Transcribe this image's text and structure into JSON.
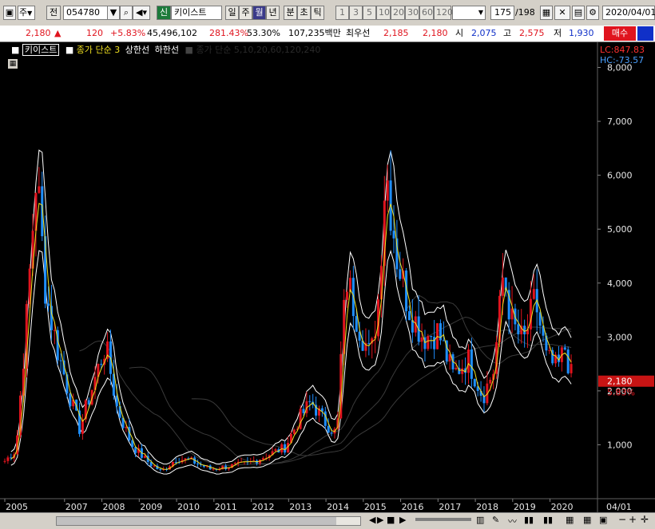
{
  "toolbar": {
    "market": "주",
    "prev_label": "전",
    "code": "054780",
    "mode_badge": "신",
    "stock_name": "키이스트",
    "periods": [
      "일",
      "주",
      "월",
      "년",
      "분",
      "초",
      "틱"
    ],
    "active_period": "월",
    "nums": [
      "1",
      "3",
      "5",
      "10",
      "20",
      "30",
      "60",
      "120"
    ],
    "page_count": "175",
    "page_total": "/198",
    "date": "2020/04/01"
  },
  "quote": {
    "price": "2,180",
    "change": "120",
    "pct": "+5.83%",
    "volume": "45,496,102",
    "vol_ratio": "281.43%",
    "turnover": "53.30%",
    "amount": "107,235백만",
    "best_label": "최우선",
    "best_ask": "2,185",
    "best_bid": "2,180",
    "open_label": "시",
    "open": "2,075",
    "high_label": "고",
    "high": "2,575",
    "low_label": "저",
    "low": "1,930",
    "buy_label": "매수"
  },
  "legend": {
    "name": "키이스트",
    "ma_label": "종가 단순 3",
    "upper": "상한선",
    "lower": "하한선",
    "ma_list": "종가 단순 5,10,20,60,120,240"
  },
  "chart_data": {
    "type": "candlestick",
    "x_ticks": [
      "2005",
      "2007",
      "2008",
      "2009",
      "2010",
      "2011",
      "2012",
      "2013",
      "2014",
      "2015",
      "2016",
      "2017",
      "2018",
      "2019",
      "2020",
      "04/01"
    ],
    "y_ticks": [
      "8,000",
      "7,000",
      "6,000",
      "5,000",
      "4,000",
      "3,000",
      "2,000",
      "1,000"
    ],
    "ylim": [
      0,
      8200
    ],
    "lc": "LC:847.83",
    "hc": "HC:-73.57",
    "last_price": "2,180",
    "last_pct": "5.83%",
    "close_profile": [
      {
        "x": 2005.0,
        "y": 700
      },
      {
        "x": 2005.3,
        "y": 900
      },
      {
        "x": 2005.6,
        "y": 3500
      },
      {
        "x": 2005.85,
        "y": 6100
      },
      {
        "x": 2006.1,
        "y": 3800
      },
      {
        "x": 2006.4,
        "y": 2800
      },
      {
        "x": 2006.7,
        "y": 2000
      },
      {
        "x": 2007.0,
        "y": 1300
      },
      {
        "x": 2007.4,
        "y": 2200
      },
      {
        "x": 2007.7,
        "y": 2850
      },
      {
        "x": 2008.0,
        "y": 1700
      },
      {
        "x": 2008.4,
        "y": 1000
      },
      {
        "x": 2008.8,
        "y": 700
      },
      {
        "x": 2009.2,
        "y": 500
      },
      {
        "x": 2009.6,
        "y": 750
      },
      {
        "x": 2010.0,
        "y": 700
      },
      {
        "x": 2010.5,
        "y": 550
      },
      {
        "x": 2011.0,
        "y": 600
      },
      {
        "x": 2011.5,
        "y": 650
      },
      {
        "x": 2012.0,
        "y": 800
      },
      {
        "x": 2012.5,
        "y": 950
      },
      {
        "x": 2012.9,
        "y": 1500
      },
      {
        "x": 2013.2,
        "y": 1800
      },
      {
        "x": 2013.6,
        "y": 1400
      },
      {
        "x": 2013.9,
        "y": 1200
      },
      {
        "x": 2014.0,
        "y": 2600
      },
      {
        "x": 2014.15,
        "y": 4100
      },
      {
        "x": 2014.5,
        "y": 3200
      },
      {
        "x": 2014.8,
        "y": 2600
      },
      {
        "x": 2015.0,
        "y": 3700
      },
      {
        "x": 2015.2,
        "y": 6200
      },
      {
        "x": 2015.5,
        "y": 4500
      },
      {
        "x": 2015.8,
        "y": 3600
      },
      {
        "x": 2016.2,
        "y": 3000
      },
      {
        "x": 2016.6,
        "y": 3100
      },
      {
        "x": 2017.0,
        "y": 2300
      },
      {
        "x": 2017.4,
        "y": 2600
      },
      {
        "x": 2017.8,
        "y": 1900
      },
      {
        "x": 2018.1,
        "y": 2400
      },
      {
        "x": 2018.35,
        "y": 4200
      },
      {
        "x": 2018.6,
        "y": 3200
      },
      {
        "x": 2018.9,
        "y": 2900
      },
      {
        "x": 2019.2,
        "y": 3700
      },
      {
        "x": 2019.5,
        "y": 2600
      },
      {
        "x": 2019.8,
        "y": 2400
      },
      {
        "x": 2020.0,
        "y": 2800
      },
      {
        "x": 2020.2,
        "y": 2180
      }
    ]
  },
  "colors": {
    "up": "#e0141e",
    "down": "#1f8fff",
    "ma": "#f0e020",
    "band": "#ffffff",
    "chart_bg": "#000000"
  }
}
